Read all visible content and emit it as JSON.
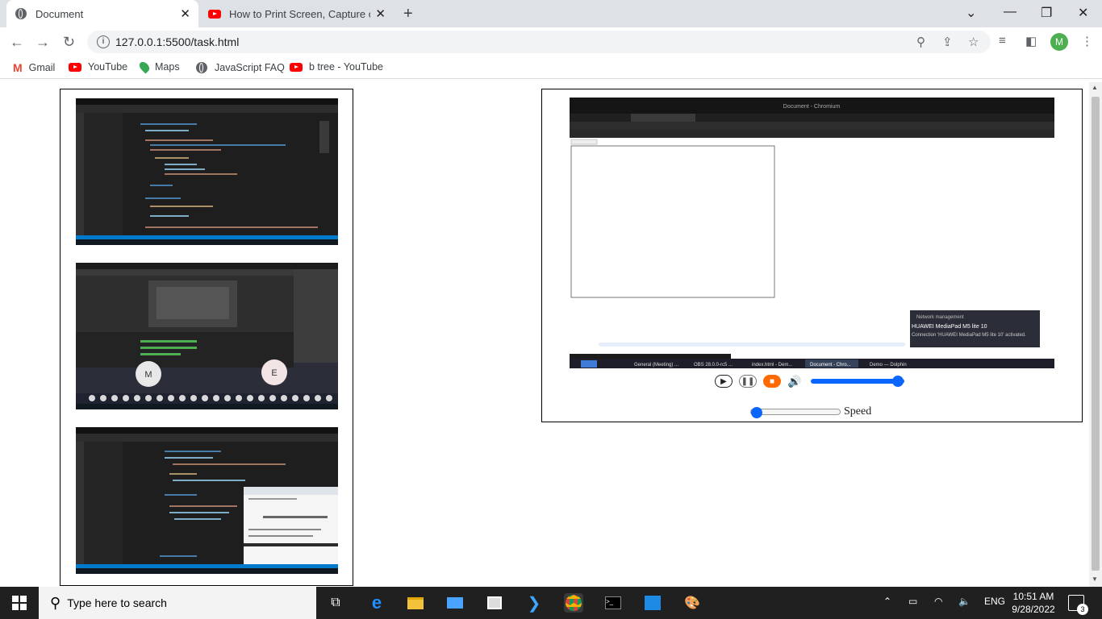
{
  "browser": {
    "tabs": [
      {
        "title": "Document",
        "active": true
      },
      {
        "title": "How to Print Screen, Capture or S",
        "active": false
      }
    ],
    "url": "127.0.0.1:5500/task.html",
    "avatar_letter": "M",
    "bookmarks": [
      "Gmail",
      "YouTube",
      "Maps",
      "JavaScript FAQ",
      "b tree - YouTube"
    ]
  },
  "page": {
    "speed_label": "Speed",
    "inner_window_title": "Document - Chromium",
    "network_popup": {
      "title": "Network management",
      "device": "HUAWEI MediaPad M5 lite 10",
      "status": "Connection 'HUAWEI MediaPad M5 lite 10' activated."
    },
    "inner_taskbar_items": [
      "General (Meeting) ...",
      "OBS 28.0.0-rc5 ...",
      "index.html - Dem...",
      "Document - Chro...",
      "Demo — Dolphin"
    ],
    "thumb2_avatars": [
      "M",
      "E"
    ]
  },
  "taskbar": {
    "search_placeholder": "Type here to search",
    "language": "ENG",
    "time": "10:51 AM",
    "date": "9/28/2022",
    "notifications": "3"
  },
  "colors": {
    "accent": "#0a66ff",
    "stop": "#ff6a00",
    "taskbar": "#202020"
  }
}
